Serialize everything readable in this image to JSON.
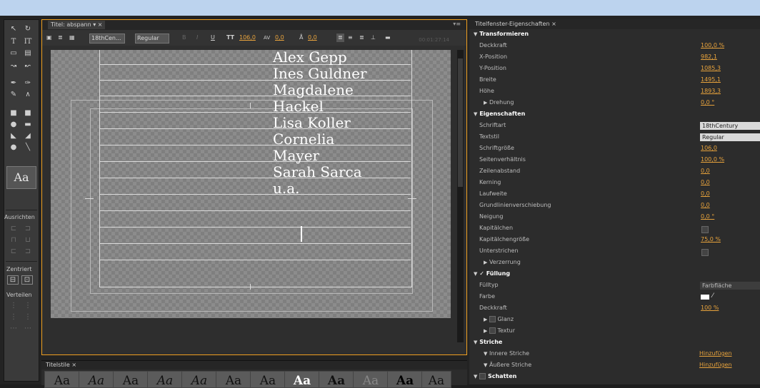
{
  "title_panel": {
    "tab_label": "Titel: abspann",
    "font_select": "18thCen...",
    "style_select": "Regular",
    "size_value": "106,0",
    "kerning_value": "0,0",
    "baseline_value": "0,0",
    "timecode": "00:01:27:14"
  },
  "credits": [
    "Alex Gepp",
    "Ines Guldner",
    "Magdalene",
    "Hackel",
    "Lisa Koller",
    "Cornelia",
    "Mayer",
    "Sarah Sarca",
    "u.a."
  ],
  "tool_panel": {
    "ausrichten": "Ausrichten",
    "zentriert": "Zentriert",
    "verteilen": "Verteilen",
    "aa_sample": "Aa"
  },
  "styles_panel": {
    "tab_label": "Titelstile",
    "samples": [
      "Aa",
      "Aa",
      "Aa",
      "Aa",
      "Aa",
      "Aa",
      "Aa",
      "Aa",
      "Aa",
      "Aa",
      "Aa",
      "Aa"
    ]
  },
  "properties": {
    "tab_label": "Titelfenster-Eigenschaften",
    "transformieren": {
      "header": "Transformieren",
      "deckkraft_label": "Deckkraft",
      "deckkraft": "100,0 %",
      "xpos_label": "X-Position",
      "xpos": "982,1",
      "ypos_label": "Y-Position",
      "ypos": "1085,3",
      "breite_label": "Breite",
      "breite": "1495,1",
      "hoehe_label": "Höhe",
      "hoehe": "1893,3",
      "drehung_label": "Drehung",
      "drehung": "0,0 °"
    },
    "eigenschaften": {
      "header": "Eigenschaften",
      "schriftart_label": "Schriftart",
      "schriftart": "18thCentury",
      "textstil_label": "Textstil",
      "textstil": "Regular",
      "groesse_label": "Schriftgröße",
      "groesse": "106,0",
      "seiten_label": "Seitenverhältnis",
      "seiten": "100,0 %",
      "zeilen_label": "Zeilenabstand",
      "zeilen": "0,0",
      "kerning_label": "Kerning",
      "kerning": "0,0",
      "laufweite_label": "Laufweite",
      "laufweite": "0,0",
      "grundlinie_label": "Grundlinienverschiebung",
      "grundlinie": "0,0",
      "neigung_label": "Neigung",
      "neigung": "0,0 °",
      "kapitaelchen_label": "Kapitälchen",
      "kapgroesse_label": "Kapitälchengröße",
      "kapgroesse": "75,0 %",
      "unterstrichen_label": "Unterstrichen",
      "verzerrung_label": "Verzerrung"
    },
    "fuellung": {
      "header": "Füllung",
      "fuelltyp_label": "Fülltyp",
      "fuelltyp": "Farbfläche",
      "farbe_label": "Farbe",
      "deckkraft_label": "Deckkraft",
      "deckkraft": "100 %",
      "glanz_label": "Glanz",
      "textur_label": "Textur"
    },
    "striche": {
      "header": "Striche",
      "innere_label": "Innere Striche",
      "innere": "Hinzufügen",
      "aeussere_label": "Äußere Striche",
      "aeussere": "Hinzufügen"
    },
    "schatten_label": "Schatten"
  },
  "colors": {
    "accent": "#e8a33c",
    "panel_border": "#f0a020",
    "topbar": "#bcd3ee"
  }
}
